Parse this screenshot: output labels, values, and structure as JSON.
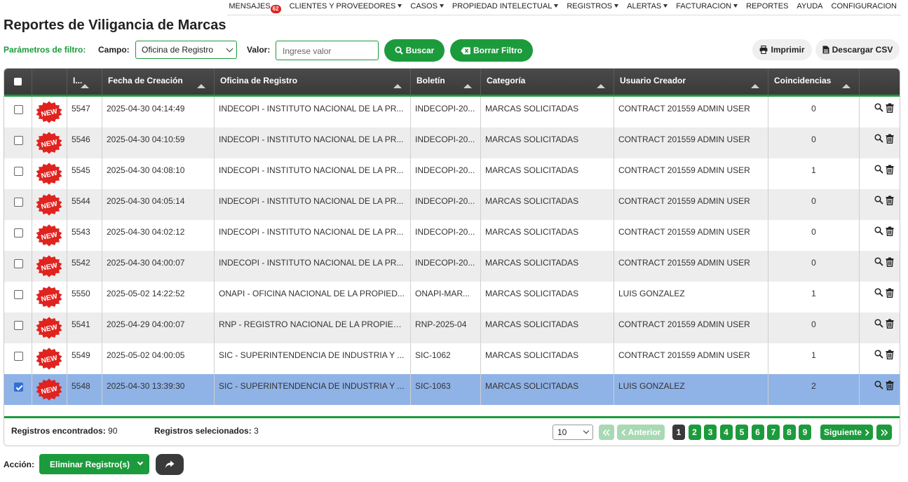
{
  "nav": {
    "items": [
      {
        "label": "MENSAJES",
        "badge": "62",
        "caret": false
      },
      {
        "label": "CLIENTES Y PROVEEDORES",
        "caret": true
      },
      {
        "label": "CASOS",
        "caret": true
      },
      {
        "label": "PROPIEDAD INTELECTUAL",
        "caret": true
      },
      {
        "label": "REGISTROS",
        "caret": true
      },
      {
        "label": "ALERTAS",
        "caret": true
      },
      {
        "label": "FACTURACION",
        "caret": true
      },
      {
        "label": "REPORTES",
        "caret": false
      },
      {
        "label": "AYUDA",
        "caret": false
      },
      {
        "label": "CONFIGURACION",
        "caret": false
      }
    ]
  },
  "page": {
    "title": "Reportes de Viligancia de Marcas"
  },
  "filters": {
    "title": "Parámetros de filtro:",
    "campo_label": "Campo:",
    "campo_value": "Oficina de Registro",
    "valor_label": "Valor:",
    "valor_placeholder": "Ingrese valor",
    "buscar": "Buscar",
    "borrar": "Borrar Filtro",
    "imprimir": "Imprimir",
    "descargar": "Descargar CSV"
  },
  "table": {
    "columns": [
      "I...",
      "Fecha de Creación",
      "Oficina de Registro",
      "Boletín",
      "Categoría",
      "Usuario Creador",
      "Coincidencias"
    ],
    "new_label": "NEW",
    "rows": [
      {
        "id": "5547",
        "fecha": "2025-04-30 04:14:49",
        "oficina": "INDECOPI - INSTITUTO NACIONAL DE LA PR...",
        "boletin": "INDECOPI-20...",
        "categoria": "MARCAS SOLICITADAS",
        "usuario": "CONTRACT 201559 ADMIN USER",
        "coincidencias": "0",
        "checked": false
      },
      {
        "id": "5546",
        "fecha": "2025-04-30 04:10:59",
        "oficina": "INDECOPI - INSTITUTO NACIONAL DE LA PR...",
        "boletin": "INDECOPI-20...",
        "categoria": "MARCAS SOLICITADAS",
        "usuario": "CONTRACT 201559 ADMIN USER",
        "coincidencias": "0",
        "checked": false
      },
      {
        "id": "5545",
        "fecha": "2025-04-30 04:08:10",
        "oficina": "INDECOPI - INSTITUTO NACIONAL DE LA PR...",
        "boletin": "INDECOPI-20...",
        "categoria": "MARCAS SOLICITADAS",
        "usuario": "CONTRACT 201559 ADMIN USER",
        "coincidencias": "1",
        "checked": false
      },
      {
        "id": "5544",
        "fecha": "2025-04-30 04:05:14",
        "oficina": "INDECOPI - INSTITUTO NACIONAL DE LA PR...",
        "boletin": "INDECOPI-20...",
        "categoria": "MARCAS SOLICITADAS",
        "usuario": "CONTRACT 201559 ADMIN USER",
        "coincidencias": "0",
        "checked": false
      },
      {
        "id": "5543",
        "fecha": "2025-04-30 04:02:12",
        "oficina": "INDECOPI - INSTITUTO NACIONAL DE LA PR...",
        "boletin": "INDECOPI-20...",
        "categoria": "MARCAS SOLICITADAS",
        "usuario": "CONTRACT 201559 ADMIN USER",
        "coincidencias": "0",
        "checked": false
      },
      {
        "id": "5542",
        "fecha": "2025-04-30 04:00:07",
        "oficina": "INDECOPI - INSTITUTO NACIONAL DE LA PR...",
        "boletin": "INDECOPI-20...",
        "categoria": "MARCAS SOLICITADAS",
        "usuario": "CONTRACT 201559 ADMIN USER",
        "coincidencias": "0",
        "checked": false
      },
      {
        "id": "5550",
        "fecha": "2025-05-02 14:22:52",
        "oficina": "ONAPI - OFICINA NACIONAL DE LA PROPIED...",
        "boletin": "ONAPI-MAR...",
        "categoria": "MARCAS SOLICITADAS",
        "usuario": "LUIS GONZALEZ",
        "coincidencias": "1",
        "checked": false
      },
      {
        "id": "5541",
        "fecha": "2025-04-29 04:00:07",
        "oficina": "RNP - REGISTRO NACIONAL DE LA PROPIED...",
        "boletin": "RNP-2025-04",
        "categoria": "MARCAS SOLICITADAS",
        "usuario": "CONTRACT 201559 ADMIN USER",
        "coincidencias": "0",
        "checked": false
      },
      {
        "id": "5549",
        "fecha": "2025-05-02 04:00:05",
        "oficina": "SIC - SUPERINTENDENCIA DE INDUSTRIA Y ...",
        "boletin": "SIC-1062",
        "categoria": "MARCAS SOLICITADAS",
        "usuario": "CONTRACT 201559 ADMIN USER",
        "coincidencias": "1",
        "checked": false
      },
      {
        "id": "5548",
        "fecha": "2025-04-30 13:39:30",
        "oficina": "SIC - SUPERINTENDENCIA DE INDUSTRIA Y ...",
        "boletin": "SIC-1063",
        "categoria": "MARCAS SOLICITADAS",
        "usuario": "LUIS GONZALEZ",
        "coincidencias": "2",
        "checked": true
      }
    ]
  },
  "footer": {
    "encontrados_label": "Registros encontrados:",
    "encontrados": "90",
    "seleccionados_label": "Registros selecionados:",
    "seleccionados": "3",
    "page_size": "10",
    "anterior": "Anterior",
    "siguiente": "Siguiente",
    "pages": [
      "1",
      "2",
      "3",
      "4",
      "5",
      "6",
      "7",
      "8",
      "9"
    ],
    "current_page": "1"
  },
  "action": {
    "label": "Acción:",
    "selected": "Eliminar Registro(s)"
  },
  "colors": {
    "accent": "#1c9b3c",
    "selected_row": "#8fb3e6",
    "header": "#3f3f3f",
    "badge": "#e0231e"
  }
}
